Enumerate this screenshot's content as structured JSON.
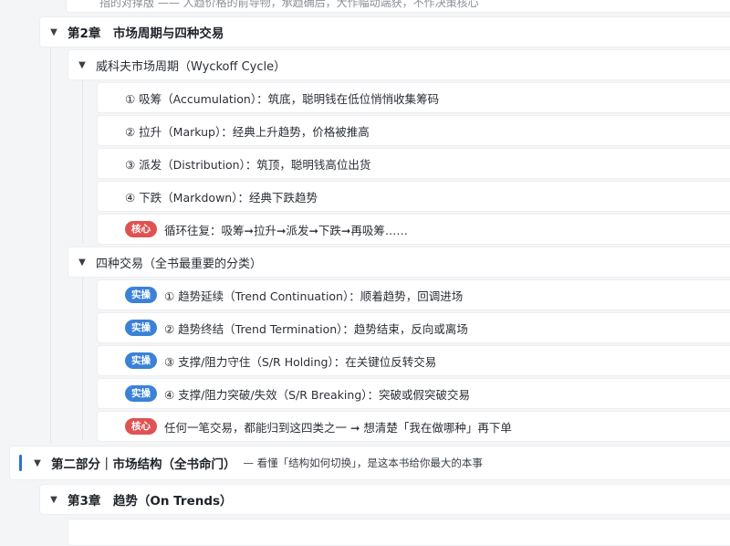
{
  "top_cut": {
    "text": "指的对撑版  —— 人趋价格的前导物，承趋确后，大作幅动端获，不作决策核心"
  },
  "chapter2": {
    "title": "第2章　市场周期与四种交易"
  },
  "wyckoff": {
    "title": "威科夫市场周期（Wyckoff Cycle）",
    "items": [
      {
        "text": "① 吸筹（Accumulation）：筑底，聪明钱在低位悄悄收集筹码"
      },
      {
        "text": "② 拉升（Markup）：经典上升趋势，价格被推高"
      },
      {
        "text": "③ 派发（Distribution）：筑顶，聪明钱高位出货"
      },
      {
        "text": "④ 下跌（Markdown）：经典下跌趋势"
      }
    ],
    "core": {
      "badge": "核心",
      "text": "循环往复：吸筹➞拉升➞派发➞下跌➞再吸筹……"
    }
  },
  "four_trades": {
    "title": "四种交易（全书最重要的分类）",
    "items": [
      {
        "badge": "实操",
        "text": "① 趋势延续（Trend Continuation）：顺着趋势，回调进场"
      },
      {
        "badge": "实操",
        "text": "② 趋势终结（Trend Termination）：趋势结束，反向或离场"
      },
      {
        "badge": "实操",
        "text": "③ 支撑/阻力守住（S/R Holding）：在关键位反转交易"
      },
      {
        "badge": "实操",
        "text": "④ 支撑/阻力突破/失效（S/R Breaking）：突破或假突破交易"
      }
    ],
    "core": {
      "badge": "核心",
      "text": "任何一笔交易，都能归到这四类之一 ➞ 想清楚「我在做哪种」再下单"
    }
  },
  "part2": {
    "title": "第二部分｜市场结构（全书命门）",
    "note": "— 看懂「结构如何切换」，是这本书给你最大的本事"
  },
  "chapter3": {
    "title": "第3章　趋势（On Trends）"
  },
  "icons": {
    "expand": "▼"
  },
  "colors": {
    "core_badge": "#e05252",
    "practice_badge": "#3b82d6",
    "part_accent": "#2f6fd1"
  }
}
